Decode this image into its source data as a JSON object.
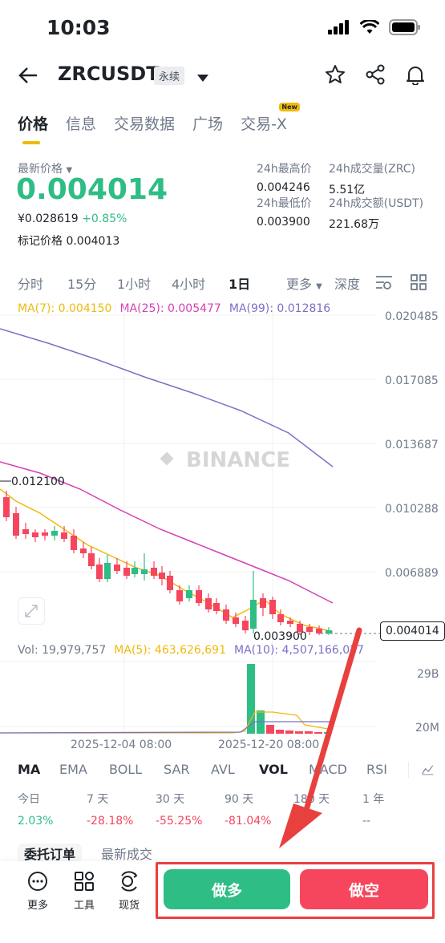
{
  "status": {
    "time": "10:03"
  },
  "header": {
    "symbol": "ZRCUSDT",
    "contract_type": "永续"
  },
  "tabs": [
    {
      "label": "价格",
      "active": true
    },
    {
      "label": "信息"
    },
    {
      "label": "交易数据"
    },
    {
      "label": "广场"
    },
    {
      "label": "交易-X",
      "badge": "New"
    }
  ],
  "price": {
    "label": "最新价格",
    "value": "0.004014",
    "cny": "¥0.028619",
    "change": "+0.85%",
    "mark_label": "标记价格",
    "mark_value": "0.004013"
  },
  "stats": [
    {
      "label": "24h最高价",
      "value": "0.004246"
    },
    {
      "label": "24h成交量(ZRC)",
      "value": "5.51亿"
    },
    {
      "label": "24h最低价",
      "value": "0.003900"
    },
    {
      "label": "24h成交额(USDT)",
      "value": "221.68万"
    }
  ],
  "intervals": [
    "分时",
    "15分",
    "1小时",
    "4小时",
    "1日",
    "更多",
    "深度"
  ],
  "ma": {
    "ma7": "MA(7): 0.004150",
    "ma25": "MA(25): 0.005477",
    "ma99": "MA(99): 0.012816"
  },
  "chart": {
    "watermark": "BINANCE",
    "y_labels": [
      "0.020485",
      "0.017085",
      "0.013687",
      "0.010288",
      "0.006889"
    ],
    "high_marker": "0.012100",
    "low_marker": "0.003900",
    "current_price": "0.004014",
    "x_labels": [
      "2025-12-04 08:00",
      "2025-12-20 08:00"
    ],
    "vol_axis": [
      "29B",
      "20M"
    ]
  },
  "volume": {
    "vol": "Vol: 19,979,757",
    "ma5": "MA(5): 463,626,691",
    "ma10": "MA(10): 4,507,166,027"
  },
  "indicators": [
    "MA",
    "EMA",
    "BOLL",
    "SAR",
    "AVL",
    "VOL",
    "MACD",
    "RSI"
  ],
  "performance": [
    {
      "label": "今日",
      "value": "2.03%"
    },
    {
      "label": "7 天",
      "value": "-28.18%"
    },
    {
      "label": "30 天",
      "value": "-55.25%"
    },
    {
      "label": "90 天",
      "value": "-81.04%"
    },
    {
      "label": "180 天",
      "value": "--"
    },
    {
      "label": "1 年",
      "value": "--"
    }
  ],
  "bottom_tabs": [
    "委托订单",
    "最新成交"
  ],
  "toolbar": {
    "more": "更多",
    "tools": "工具",
    "spot": "现货",
    "long": "做多",
    "short": "做空"
  },
  "colors": {
    "green": "#2ebd85",
    "red": "#f6465d",
    "yellow": "#f0b90b",
    "ma25": "#d63fb5",
    "ma99": "#7a70c9"
  }
}
